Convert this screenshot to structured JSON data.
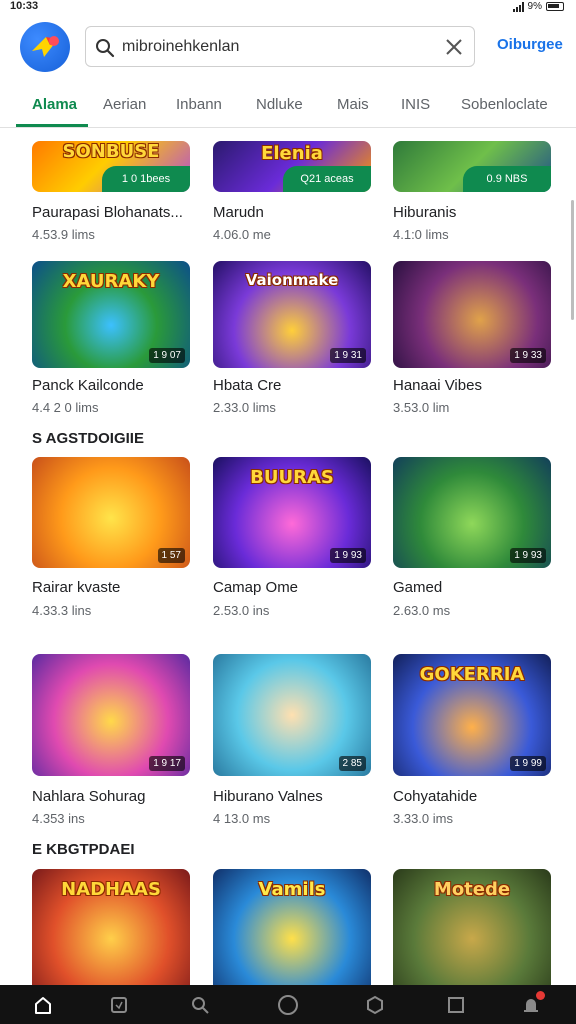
{
  "status": {
    "time": "10:33",
    "battery_text": "9%"
  },
  "header": {
    "search_value": "mibroinehkenlan",
    "link_label": "Oiburgee"
  },
  "tabs": [
    {
      "label": "Alama",
      "active": true
    },
    {
      "label": "Aerian",
      "active": false
    },
    {
      "label": "Inbann",
      "active": false
    },
    {
      "label": "Ndluke",
      "active": false
    },
    {
      "label": "Mais",
      "active": false
    },
    {
      "label": "INIS",
      "active": false
    },
    {
      "label": "Sobenloclate",
      "active": false
    }
  ],
  "sections": [
    {
      "title": "S AGSTDOIGIIE"
    },
    {
      "title": "E KBGTPDAEI"
    }
  ],
  "rows": [
    [
      {
        "name": "Paurapasi Blohanats...",
        "meta": "4.53.9 lims",
        "art_title": "SONBUSE",
        "pill": "1 0 1bees"
      },
      {
        "name": "Marudn",
        "meta": "4.06.0 me",
        "art_title": "Elenia",
        "pill": "Q21 aceas"
      },
      {
        "name": "Hiburanis",
        "meta": "4.1:0 lims",
        "art_title": "",
        "pill": "0.9 NBS"
      }
    ],
    [
      {
        "name": "Panck Kailconde",
        "meta": "4.4 2 0 lims",
        "art_title": "XAURAKY",
        "badge": "1 9 07"
      },
      {
        "name": "Hbata Cre",
        "meta": "2.33.0 lims",
        "art_title": "Vaionmake",
        "badge": "1 9 31"
      },
      {
        "name": "Hanaai Vibes",
        "meta": "3.53.0 lim",
        "art_title": "",
        "badge": "1 9 33"
      }
    ],
    [
      {
        "name": "Rairar kvaste",
        "meta": "4.33.3 lins",
        "art_title": "",
        "badge": "1 57"
      },
      {
        "name": "Camap Ome",
        "meta": "2.53.0 ins",
        "art_title": "BUURAS",
        "badge": "1 9 93"
      },
      {
        "name": "Gamed",
        "meta": "2.63.0 ms",
        "art_title": "",
        "badge": "1 9 93"
      }
    ],
    [
      {
        "name": "Nahlara Sohurag",
        "meta": "4.353 ins",
        "art_title": "",
        "badge": "1 9 17"
      },
      {
        "name": "Hiburano Valnes",
        "meta": "4 13.0 ms",
        "art_title": "",
        "badge": "2 85"
      },
      {
        "name": "Cohyatahide",
        "meta": "3.33.0 ims",
        "art_title": "GOKERRIA",
        "badge": "1 9 99"
      }
    ],
    [
      {
        "name": "",
        "meta": "",
        "art_title": "NADHAAS"
      },
      {
        "name": "",
        "meta": "",
        "art_title": "Vamils"
      },
      {
        "name": "",
        "meta": "",
        "art_title": "Motede"
      }
    ]
  ],
  "colors": {
    "accent": "#0f8a4f",
    "link": "#1a73e8",
    "nav_bg": "#121212"
  },
  "icons": [
    "app-logo-icon",
    "search-icon",
    "close-icon",
    "home-icon",
    "games-icon",
    "search-nav-icon",
    "circle-icon",
    "hexagon-icon",
    "square-icon",
    "notification-icon"
  ]
}
